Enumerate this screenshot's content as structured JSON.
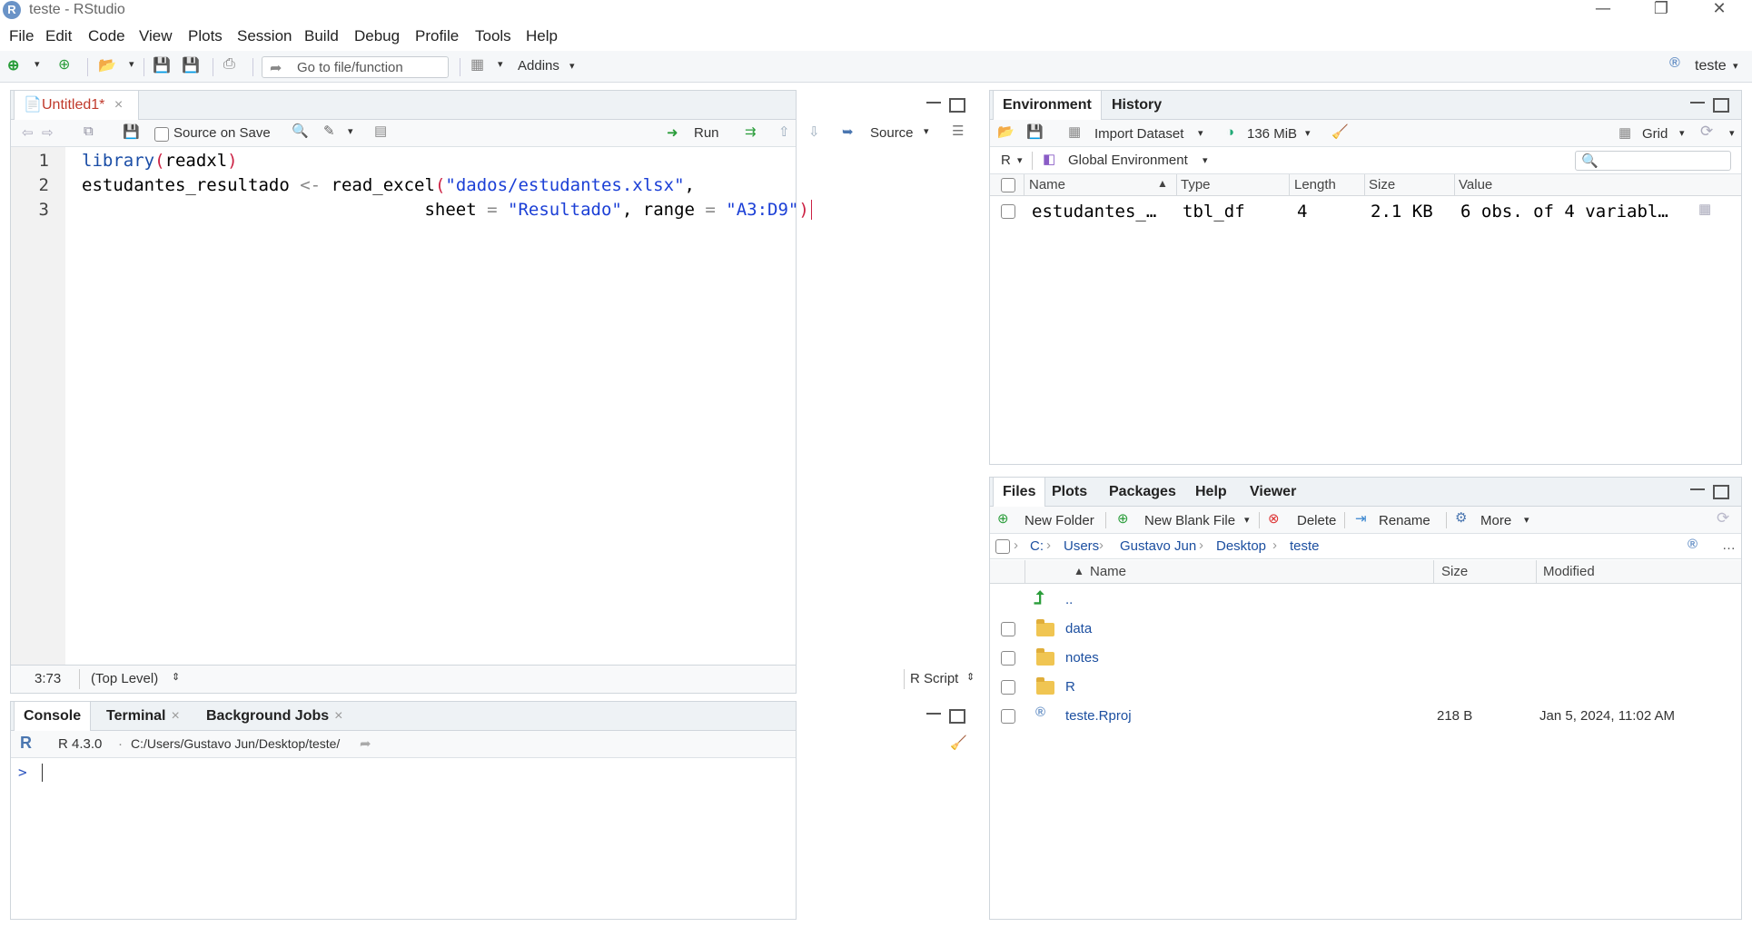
{
  "window": {
    "title": "teste - RStudio",
    "min": "—",
    "restore": "❐",
    "close": "✕"
  },
  "menu": [
    "File",
    "Edit",
    "Code",
    "View",
    "Plots",
    "Session",
    "Build",
    "Debug",
    "Profile",
    "Tools",
    "Help"
  ],
  "toolbar": {
    "goto_placeholder": "Go to file/function",
    "addins": "Addins",
    "project": "teste"
  },
  "editor": {
    "tab": "Untitled1*",
    "source_on_save": "Source on Save",
    "run": "Run",
    "source": "Source",
    "line_numbers": [
      "1",
      "2",
      "3"
    ],
    "status_pos": "3:73",
    "status_scope": "(Top Level)",
    "status_type": "R Script"
  },
  "console": {
    "tabs": [
      "Console",
      "Terminal",
      "Background Jobs"
    ],
    "version": "R 4.3.0",
    "path": "C:/Users/Gustavo Jun/Desktop/teste/",
    "prompt": ">"
  },
  "env": {
    "tabs": [
      "Environment",
      "History"
    ],
    "import": "Import Dataset",
    "memory": "136 MiB",
    "grid": "Grid",
    "lang": "R",
    "scope": "Global Environment",
    "columns": [
      "Name",
      "Type",
      "Length",
      "Size",
      "Value"
    ],
    "rows": [
      {
        "name": "estudantes_…",
        "type": "tbl_df",
        "length": "4",
        "size": "2.1 KB",
        "value": "6 obs. of 4 variabl…"
      }
    ]
  },
  "files": {
    "tabs": [
      "Files",
      "Plots",
      "Packages",
      "Help",
      "Viewer"
    ],
    "new_folder": "New Folder",
    "new_blank": "New Blank File",
    "delete": "Delete",
    "rename": "Rename",
    "more": "More",
    "crumbs": [
      "C:",
      "Users",
      "Gustavo Jun",
      "Desktop",
      "teste"
    ],
    "columns": [
      "Name",
      "Size",
      "Modified"
    ],
    "up": "..",
    "rows": [
      {
        "name": "data",
        "size": "",
        "modified": "",
        "kind": "folder"
      },
      {
        "name": "notes",
        "size": "",
        "modified": "",
        "kind": "folder"
      },
      {
        "name": "R",
        "size": "",
        "modified": "",
        "kind": "folder"
      },
      {
        "name": "teste.Rproj",
        "size": "218 B",
        "modified": "Jan 5, 2024, 11:02 AM",
        "kind": "rproj"
      }
    ]
  }
}
